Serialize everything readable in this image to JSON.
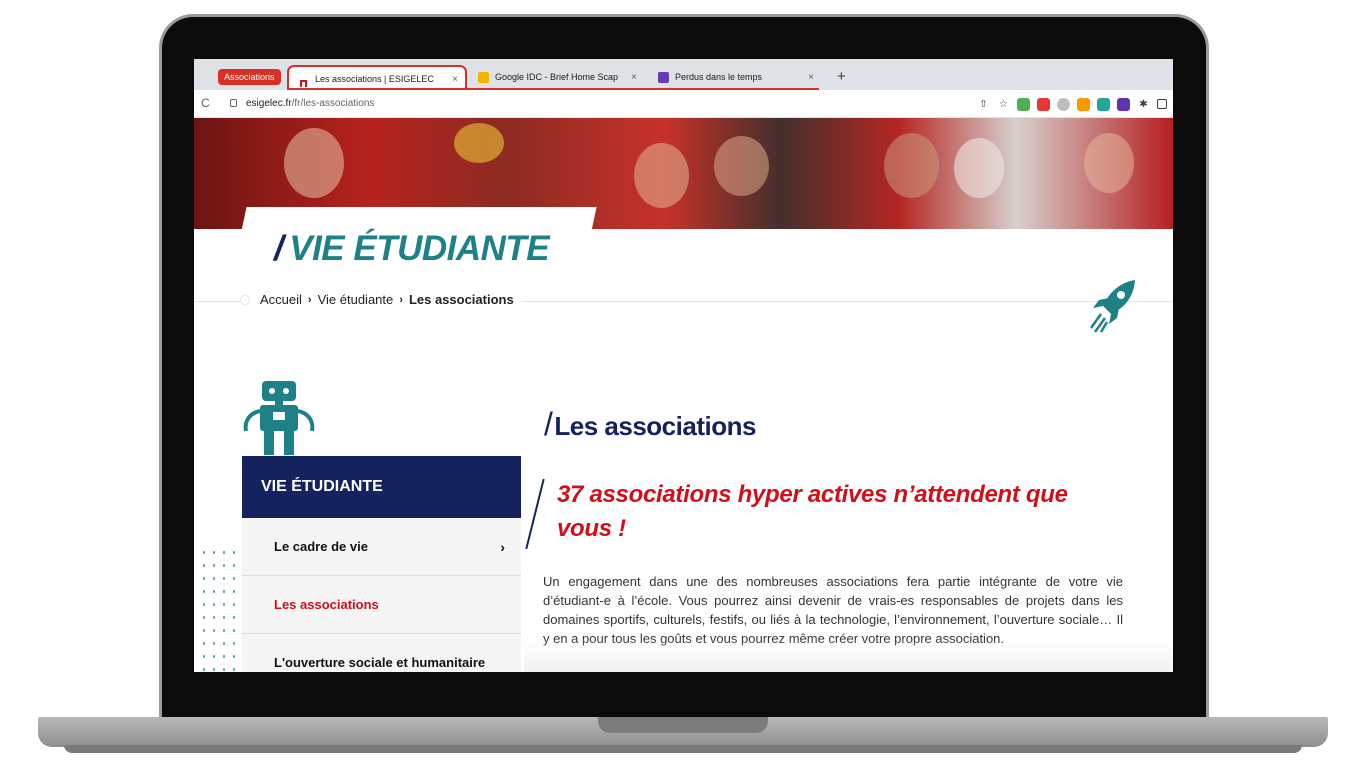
{
  "browser": {
    "tab_group_label": "Associations",
    "tabs": [
      {
        "title": "Les associations | ESIGELEC",
        "active": true
      },
      {
        "title": "Google IDC - Brief Home Scap",
        "active": false
      },
      {
        "title": "Perdus dans le temps",
        "active": false
      }
    ],
    "close_glyph": "×",
    "new_tab_glyph": "+",
    "reload_glyph": "C",
    "url_host": "esigelec.fr",
    "url_path": "/fr/les-associations",
    "share_glyph": "⇧",
    "star_glyph": "☆",
    "extensions_glyph": "✱"
  },
  "hero": {
    "title_slash": "/",
    "title": "VIE ÉTUDIANTE"
  },
  "breadcrumb": {
    "items": [
      "Accueil",
      "Vie étudiante",
      "Les associations"
    ],
    "separator": "›"
  },
  "sidebar": {
    "heading": "VIE ÉTUDIANTE",
    "items": [
      {
        "label": "Le cadre de vie",
        "chevron": "›"
      },
      {
        "label": "Les associations"
      },
      {
        "label": "L'ouverture sociale et humanitaire"
      }
    ]
  },
  "main": {
    "title_slash": "/",
    "title": "Les associations",
    "subtitle": "37 associations hyper actives n’attendent que vous !",
    "body": "Un engagement dans une des nombreuses associations fera partie intégrante de votre vie d’étudiant-e à l’école. Vous pourrez ainsi devenir de vrais-es responsables de projets dans les domaines sportifs, culturels, festifs, ou liés à la technologie, l’environnement, l’ouverture sociale… Il y en a pour tous les goûts et vous pourrez même créer votre propre association."
  },
  "colors": {
    "brand_navy": "#14225e",
    "brand_teal": "#1d8185",
    "brand_red": "#d10f1a",
    "tab_group_red": "#d93025"
  }
}
